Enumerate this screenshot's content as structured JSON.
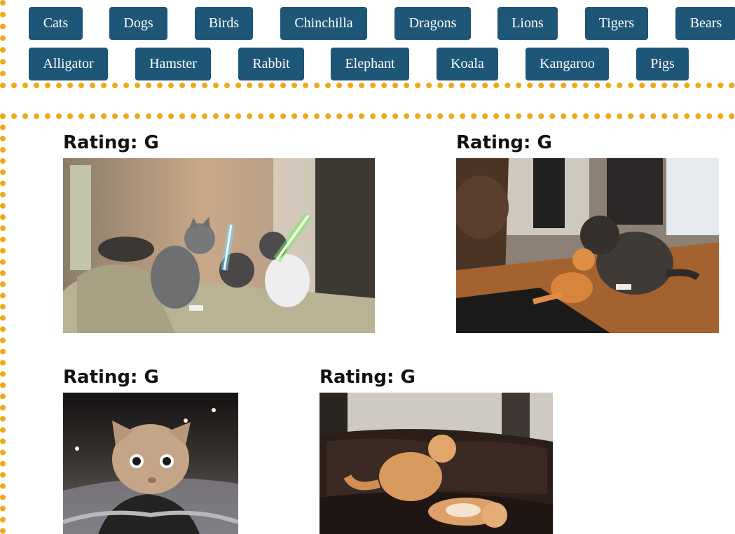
{
  "topics": [
    "Cats",
    "Dogs",
    "Birds",
    "Chinchilla",
    "Dragons",
    "Lions",
    "Tigers",
    "Bears",
    "Alligator",
    "Hamster",
    "Rabbit",
    "Elephant",
    "Koala",
    "Kangaroo",
    "Pigs"
  ],
  "gifs": [
    {
      "rating": "Rating: G",
      "icon": "lightsaber-cats-gif"
    },
    {
      "rating": "Rating: G",
      "icon": "cat-kitten-play-gif"
    },
    {
      "rating": "Rating: G",
      "icon": "motorcycle-cat-gif"
    },
    {
      "rating": "Rating: G",
      "icon": "cats-wrestling-couch-gif"
    }
  ],
  "colors": {
    "button_bg": "#1e5678",
    "button_text": "#ffffff",
    "dotted_border": "#f0a818"
  }
}
